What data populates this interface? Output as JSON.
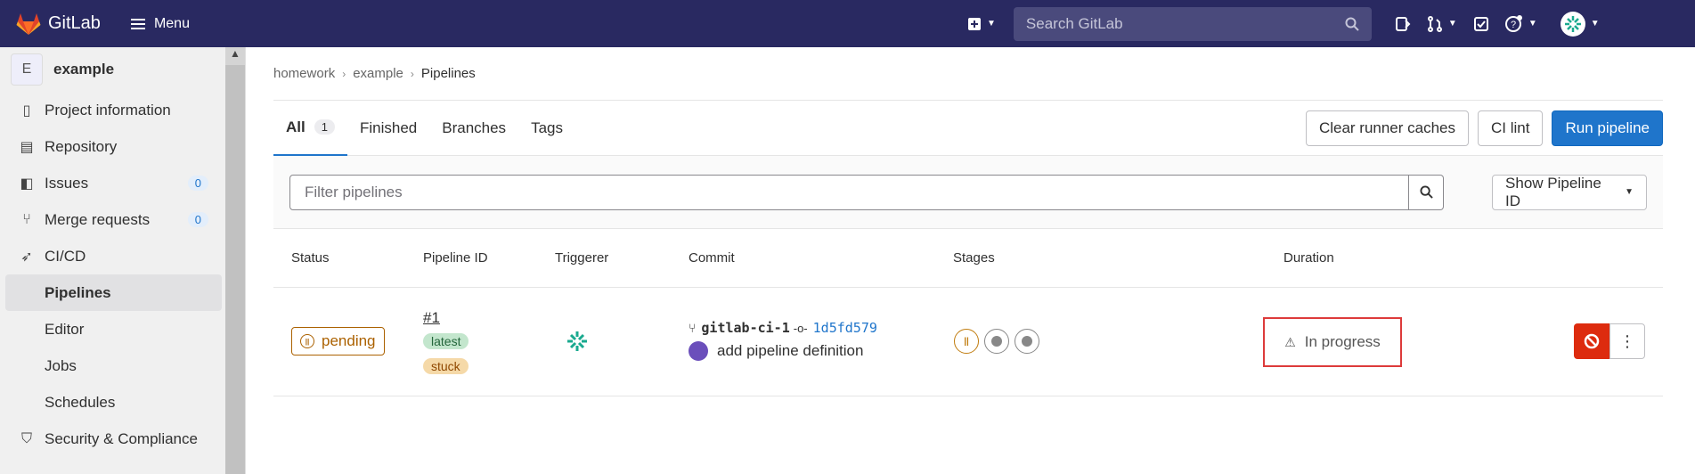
{
  "topbar": {
    "logo_text": "GitLab",
    "menu_label": "Menu",
    "search_placeholder": "Search GitLab"
  },
  "sidebar": {
    "project_initial": "E",
    "project_name": "example",
    "items": [
      {
        "label": "Project information",
        "icon": "info-icon"
      },
      {
        "label": "Repository",
        "icon": "doc-icon"
      },
      {
        "label": "Issues",
        "icon": "issues-icon",
        "count": "0"
      },
      {
        "label": "Merge requests",
        "icon": "merge-icon",
        "count": "0"
      },
      {
        "label": "CI/CD",
        "icon": "rocket-icon"
      }
    ],
    "subitems": [
      "Pipelines",
      "Editor",
      "Jobs",
      "Schedules"
    ],
    "last_item": {
      "label": "Security & Compliance",
      "icon": "shield-icon"
    }
  },
  "breadcrumb": [
    "homework",
    "example",
    "Pipelines"
  ],
  "tabs": [
    {
      "label": "All",
      "count": "1"
    },
    {
      "label": "Finished"
    },
    {
      "label": "Branches"
    },
    {
      "label": "Tags"
    }
  ],
  "actions": {
    "clear_caches": "Clear runner caches",
    "ci_lint": "CI lint",
    "run_pipeline": "Run pipeline"
  },
  "filter": {
    "placeholder": "Filter pipelines",
    "show_id": "Show Pipeline ID"
  },
  "table": {
    "headers": [
      "Status",
      "Pipeline ID",
      "Triggerer",
      "Commit",
      "Stages",
      "Duration"
    ],
    "row": {
      "status": "pending",
      "pipeline_id": "#1",
      "tags": [
        "latest",
        "stuck"
      ],
      "branch": "gitlab-ci-1",
      "sha": "1d5fd579",
      "message": "add pipeline definition",
      "duration": "In progress"
    }
  },
  "colors": {
    "topbar": "#292961",
    "accent": "#1f75cb",
    "pending": "#ab6100",
    "danger": "#dd2b0e"
  }
}
